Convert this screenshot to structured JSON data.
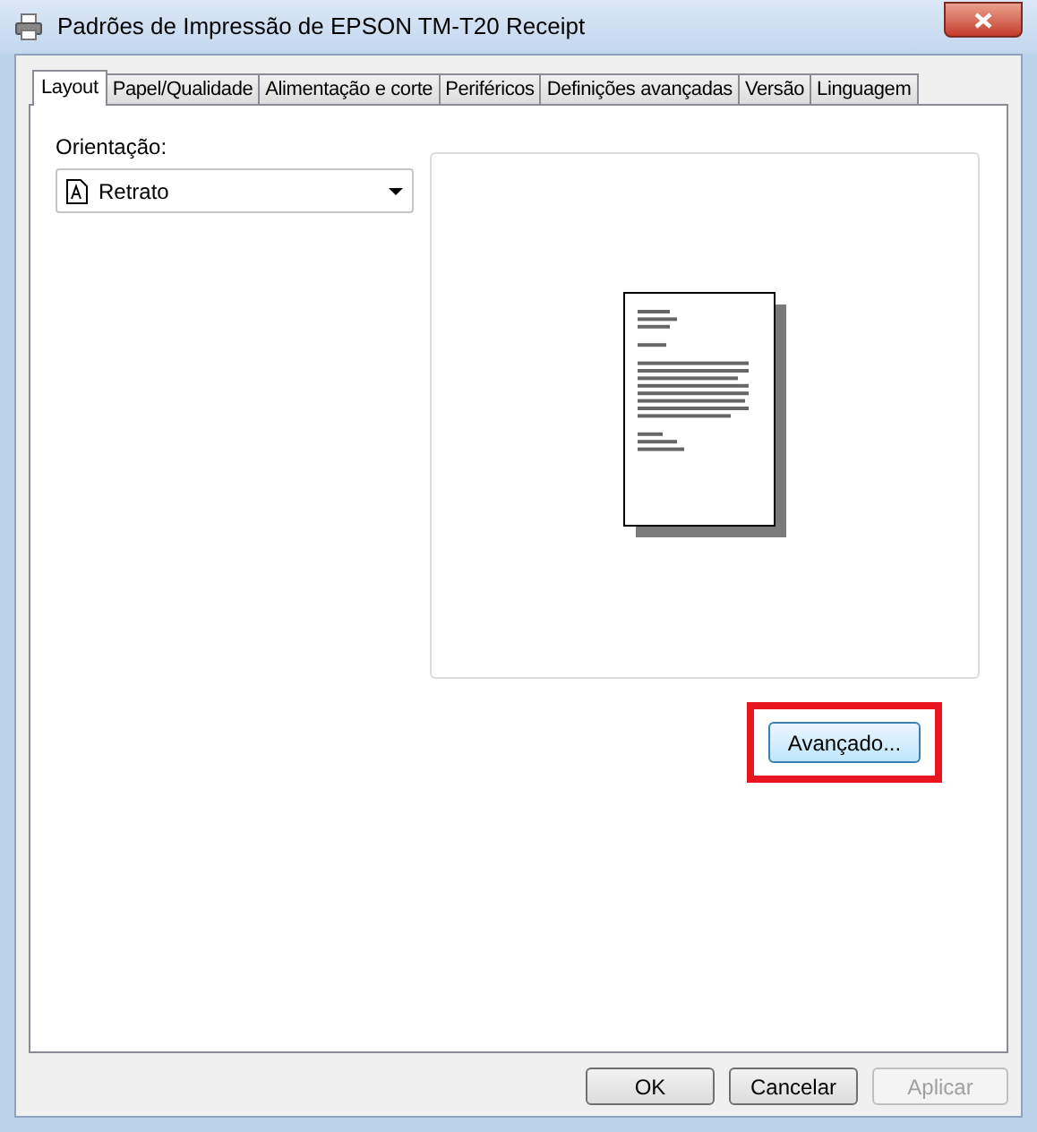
{
  "window": {
    "title": "Padrões de Impressão de EPSON TM-T20 Receipt"
  },
  "tabs": [
    {
      "label": "Layout",
      "selected": true
    },
    {
      "label": "Papel/Qualidade",
      "selected": false
    },
    {
      "label": "Alimentação e corte",
      "selected": false
    },
    {
      "label": "Periféricos",
      "selected": false
    },
    {
      "label": "Definições avançadas",
      "selected": false
    },
    {
      "label": "Versão",
      "selected": false
    },
    {
      "label": "Linguagem",
      "selected": false
    }
  ],
  "orientation": {
    "label": "Orientação:",
    "value": "Retrato"
  },
  "advanced_button": {
    "label": "Avançado...",
    "highlighted": true
  },
  "buttons": [
    {
      "label": "OK",
      "disabled": false
    },
    {
      "label": "Cancelar",
      "disabled": false
    },
    {
      "label": "Aplicar",
      "disabled": true
    }
  ]
}
